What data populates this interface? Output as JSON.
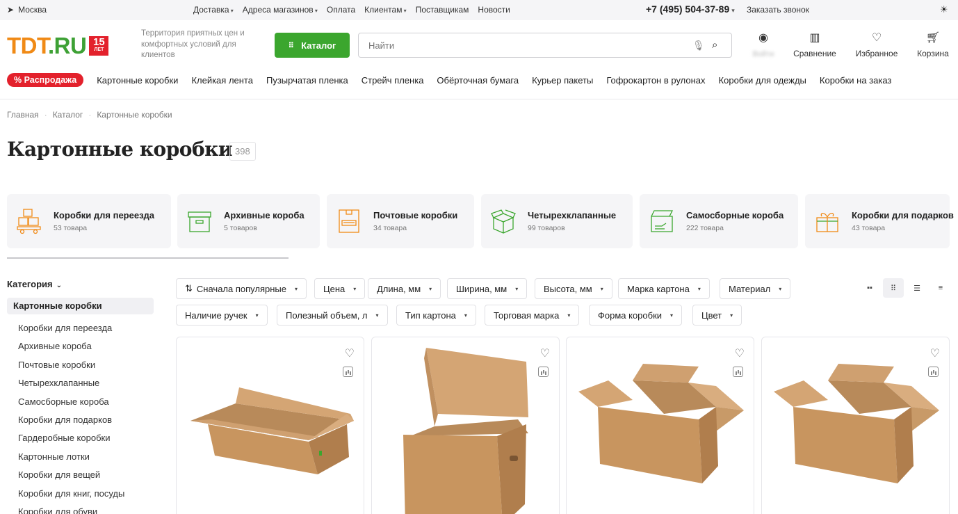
{
  "topbar": {
    "city": "Москва",
    "nav": [
      {
        "label": "Доставка",
        "dropdown": true
      },
      {
        "label": "Адреса магазинов",
        "dropdown": true
      },
      {
        "label": "Оплата",
        "dropdown": false
      },
      {
        "label": "Клиентам",
        "dropdown": true
      },
      {
        "label": "Поставщикам",
        "dropdown": false
      },
      {
        "label": "Новости",
        "dropdown": false
      }
    ],
    "phone": "+7 (495) 504-37-89",
    "callback": "Заказать звонок"
  },
  "header": {
    "logo_text": "TDT",
    "logo_suffix": ".RU",
    "logo_badge_number": "15",
    "logo_badge_label": "ЛЕТ",
    "tagline": "Территория приятных цен и комфортных условий для клиентов",
    "catalog_button": "Каталог",
    "search_placeholder": "Найти",
    "account_label": "Войти",
    "compare_label": "Сравнение",
    "favorites_label": "Избранное",
    "cart_label": "Корзина"
  },
  "catnav": {
    "sale": "% Распродажа",
    "items": [
      "Картонные коробки",
      "Клейкая лента",
      "Пузырчатая пленка",
      "Стрейч пленка",
      "Обёрточная бумага",
      "Курьер пакеты",
      "Гофрокартон в рулонах",
      "Коробки для одежды",
      "Коробки на заказ"
    ]
  },
  "breadcrumb": [
    "Главная",
    "Каталог",
    "Картонные коробки"
  ],
  "page": {
    "title": "Картонные коробки",
    "count": "398"
  },
  "tiles": [
    {
      "name": "Коробки для переезда",
      "count": "53 товара"
    },
    {
      "name": "Архивные короба",
      "count": "5 товаров"
    },
    {
      "name": "Почтовые коробки",
      "count": "34 товара"
    },
    {
      "name": "Четырехклапанные",
      "count": "99 товаров"
    },
    {
      "name": "Самосборные короба",
      "count": "222 товара"
    },
    {
      "name": "Коробки для подарков",
      "count": "43 товара"
    }
  ],
  "sidebar": {
    "title": "Категория",
    "active": "Картонные коробки",
    "items": [
      "Коробки для переезда",
      "Архивные короба",
      "Почтовые коробки",
      "Четырехклапанные",
      "Самосборные короба",
      "Коробки для подарков",
      "Гардеробные коробки",
      "Картонные лотки",
      "Коробки для вещей",
      "Коробки для книг, посуды",
      "Коробки для обуви"
    ]
  },
  "filters": {
    "sort": "Сначала популярные",
    "row1": [
      "Цена",
      "Длина, мм",
      "Ширина, мм",
      "Высота, мм",
      "Марка картона",
      "Материал"
    ],
    "row2": [
      "Наличие ручек",
      "Полезный объем, л",
      "Тип картона",
      "Торговая марка",
      "Форма коробки",
      "Цвет"
    ]
  },
  "colors": {
    "brand_orange": "#f08a16",
    "brand_green": "#3ba62e",
    "sale_red": "#e3212c",
    "cardboard": "#c8955f"
  }
}
